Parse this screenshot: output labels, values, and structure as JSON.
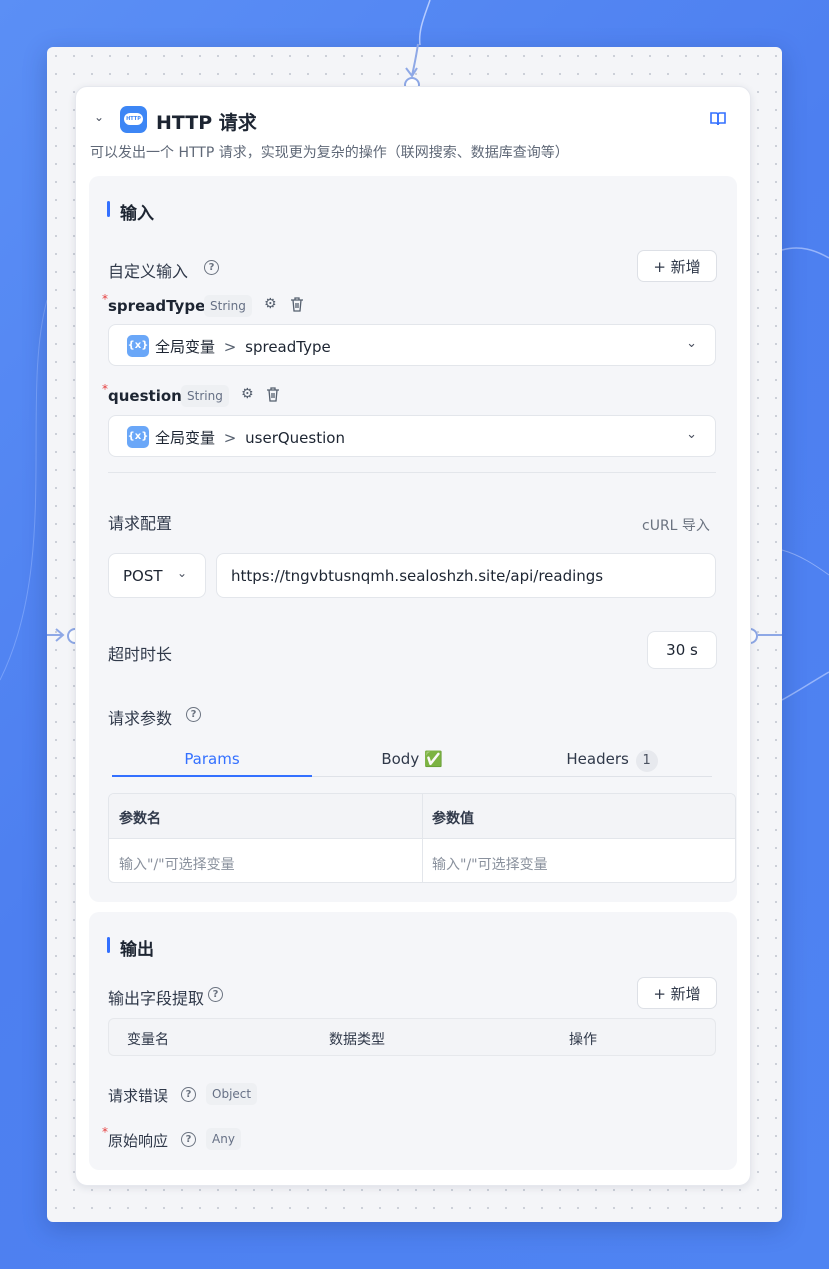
{
  "node": {
    "title": "HTTP 请求",
    "icon_name": "http-icon",
    "description": "可以发出一个 HTTP 请求，实现更为复杂的操作（联网搜索、数据库查询等）"
  },
  "inputs": {
    "section_title": "输入",
    "custom_input_label": "自定义输入",
    "add_label": "+ 新增",
    "fields": [
      {
        "name": "spreadType",
        "type": "String",
        "source": "全局变量",
        "separator": ">",
        "value": "spreadType"
      },
      {
        "name": "question",
        "type": "String",
        "source": "全局变量",
        "separator": ">",
        "value": "userQuestion"
      }
    ]
  },
  "request": {
    "label": "请求配置",
    "curl_import": "cURL 导入",
    "method": "POST",
    "url": "https://tngvbtusnqmh.sealoshzh.site/api/readings",
    "timeout_label": "超时时长",
    "timeout_value": "30 s",
    "params_label": "请求参数",
    "tabs": [
      {
        "label": "Params",
        "active": true
      },
      {
        "label": "Body",
        "badge": "✅"
      },
      {
        "label": "Headers",
        "count": "1"
      }
    ],
    "table": {
      "col_name": "参数名",
      "col_value": "参数值",
      "name_placeholder": "输入\"/\"可选择变量",
      "value_placeholder": "输入\"/\"可选择变量"
    }
  },
  "outputs": {
    "section_title": "输出",
    "extract_label": "输出字段提取",
    "add_label": "+ 新增",
    "columns": [
      "变量名",
      "数据类型",
      "操作"
    ],
    "items": [
      {
        "name": "请求错误",
        "type": "Object",
        "required": false
      },
      {
        "name": "原始响应",
        "type": "Any",
        "required": true
      }
    ]
  },
  "colors": {
    "accent": "#3370ff",
    "background": "#4d7ff0"
  }
}
